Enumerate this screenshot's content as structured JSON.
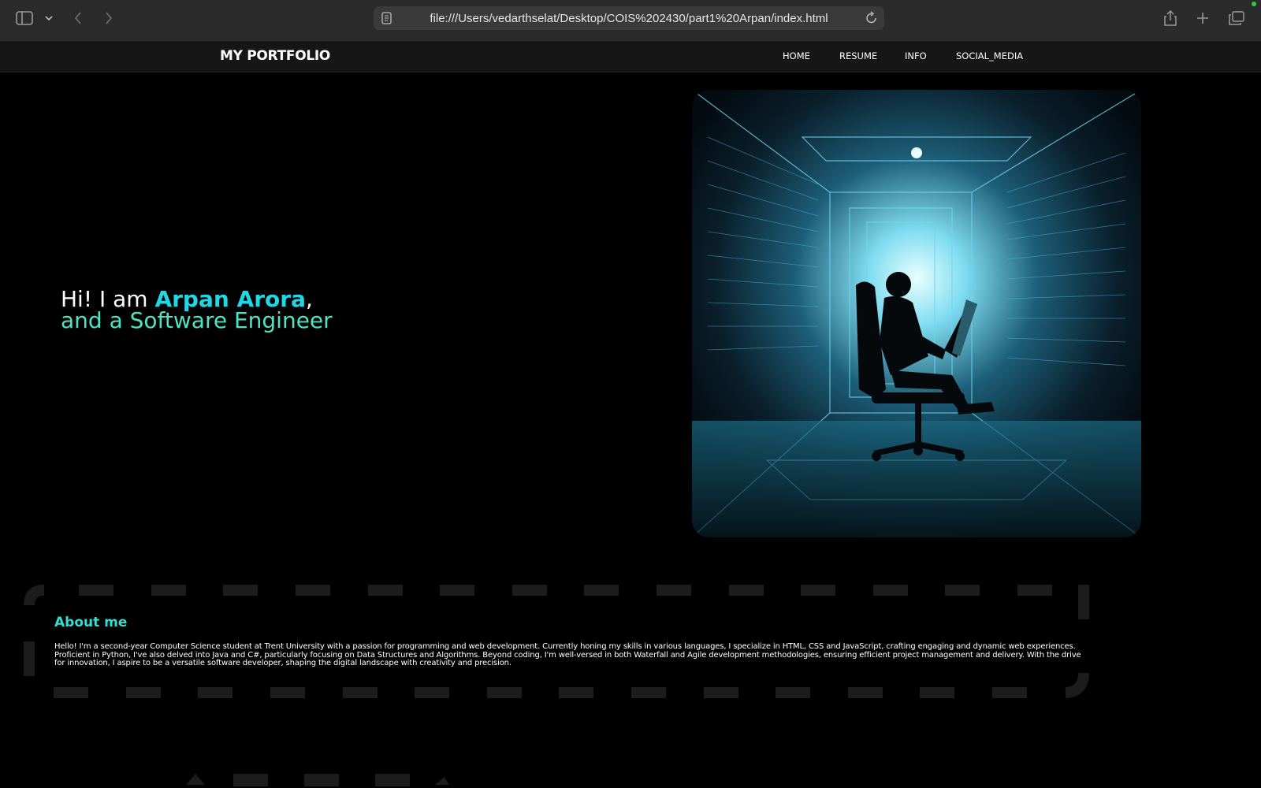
{
  "browser": {
    "url": "file:///Users/vedarthselat/Desktop/COIS%202430/part1%20Arpan/index.html",
    "icons": [
      "sidebar-icon",
      "chevron-down-icon",
      "back-icon",
      "forward-icon",
      "page-icon",
      "reload-icon",
      "share-icon",
      "new-tab-icon",
      "tabs-overview-icon"
    ]
  },
  "site": {
    "brand": "MY PORTFOLIO",
    "nav": [
      "HOME",
      "RESUME",
      "INFO",
      "SOCIAL_MEDIA"
    ]
  },
  "hero": {
    "greeting": "Hi! I am ",
    "name": "Arpan Arora",
    "comma": ",",
    "subtitle": "and a Software Engineer"
  },
  "about": {
    "title": "About me",
    "body": "Hello! I'm a second-year Computer Science student at Trent University with a passion for programming and web development. Currently honing my skills in various languages, I specialize in HTML, CSS and JavaScript, crafting engaging and dynamic web experiences. Proficient in Python, I've also delved into Java and C#, particularly focusing on Data Structures and Algorithms. Beyond coding, I'm well-versed in both Waterfall and Agile development methodologies, ensuring efficient project management and delivery. With the drive for innovation, I aspire to be a versatile software developer, shaping the digital landscape with creativity and precision."
  },
  "colors": {
    "accent_name": "#1fd8e6",
    "accent_subtitle": "#4fe3c3",
    "accent_about": "#35dcd0",
    "background": "#000000"
  }
}
